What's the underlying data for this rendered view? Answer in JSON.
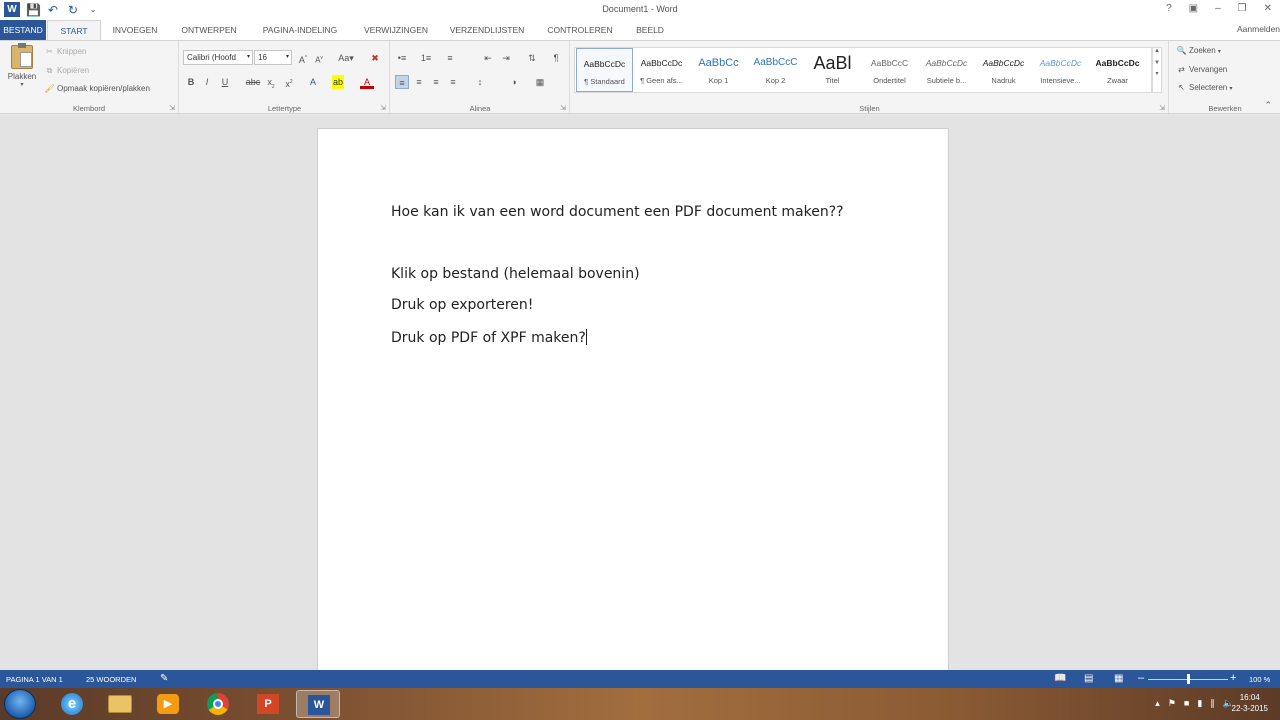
{
  "window": {
    "title": "Document1 - Word",
    "sign_in": "Aanmelden"
  },
  "tabs": [
    "BESTAND",
    "START",
    "INVOEGEN",
    "ONTWERPEN",
    "PAGINA-INDELING",
    "VERWIJZINGEN",
    "VERZENDLIJSTEN",
    "CONTROLEREN",
    "BEELD"
  ],
  "ribbon": {
    "clipboard": {
      "label": "Klembord",
      "paste": "Plakken",
      "cut": "Knippen",
      "copy": "Kopiëren",
      "format_painter": "Opmaak kopiëren/plakken"
    },
    "font": {
      "label": "Lettertype",
      "font_name": "Calibri (Hoofd",
      "font_size": "16"
    },
    "paragraph": {
      "label": "Alinea"
    },
    "styles": {
      "label": "Stijlen",
      "items": [
        {
          "preview": "AaBbCcDc",
          "name": "¶ Standaard"
        },
        {
          "preview": "AaBbCcDc",
          "name": "¶ Geen afs..."
        },
        {
          "preview": "AaBbCc",
          "name": "Kop 1"
        },
        {
          "preview": "AaBbCcC",
          "name": "Kop 2"
        },
        {
          "preview": "AaBl",
          "name": "Titel"
        },
        {
          "preview": "AaBbCcC",
          "name": "Ondertitel"
        },
        {
          "preview": "AaBbCcDc",
          "name": "Subtiele b..."
        },
        {
          "preview": "AaBbCcDc",
          "name": "Nadruk"
        },
        {
          "preview": "AaBbCcDc",
          "name": "Intensieve..."
        },
        {
          "preview": "AaBbCcDc",
          "name": "Zwaar"
        }
      ]
    },
    "editing": {
      "label": "Bewerken",
      "find": "Zoeken",
      "replace": "Vervangen",
      "select": "Selecteren"
    }
  },
  "document": {
    "paragraphs": [
      "Hoe kan ik van een word document een PDF document maken??",
      "Klik op bestand (helemaal bovenin)",
      "Druk op exporteren!",
      "Druk op PDF of XPF maken?"
    ]
  },
  "status": {
    "page": "PAGINA 1 VAN 1",
    "words": "25 WOORDEN",
    "zoom": "100 %",
    "zoom_value": 100
  },
  "taskbar": {
    "time": "16:04",
    "date": "22-3-2015"
  },
  "colors": {
    "word_blue": "#2b579a",
    "ribbon_bg": "#f4f4f4",
    "document_bg": "#e3e3e3"
  }
}
